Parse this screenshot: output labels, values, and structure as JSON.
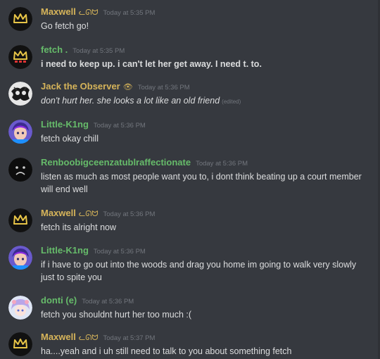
{
  "colors": {
    "background": "#36393f",
    "maxwell_name": "#d6b45a",
    "green_name": "#66bb6a",
    "timestamp": "#72767d",
    "message_text": "#dcddde"
  },
  "messages": [
    {
      "author": "Maxwell",
      "decoration": "ᓚᘏᗢ",
      "timestamp": "Today at 5:35 PM",
      "text": "Go fetch go!",
      "avatar": "crown-icon"
    },
    {
      "author": "fetch .",
      "timestamp": "Today at 5:35 PM",
      "text": "i need to keep up. i can't let her get away. I need t. to.",
      "avatar": "crown-icon"
    },
    {
      "author": "Jack the Observer",
      "decoration": "👁",
      "timestamp": "Today at 5:36 PM",
      "text": "don't hurt her. she looks a lot like an old friend",
      "edited": "(edited)",
      "avatar": "ink-avatar-icon"
    },
    {
      "author": "Little-K1ng",
      "timestamp": "Today at 5:36 PM",
      "text": "fetch okay chill",
      "avatar": "anime-avatar-icon"
    },
    {
      "author": "Renboobigceenzatublraffectionate",
      "timestamp": "Today at 5:36 PM",
      "text": "listen as much as most people want you to, i dont think beating up a court member will end well",
      "avatar": "sad-face-icon"
    },
    {
      "author": "Maxwell",
      "decoration": "ᓚᘏᗢ",
      "timestamp": "Today at 5:36 PM",
      "text": "fetch its alright now",
      "avatar": "crown-icon"
    },
    {
      "author": "Little-K1ng",
      "timestamp": "Today at 5:36 PM",
      "text": "if i have to go out into the woods and drag you home im going to walk very slowly just to spite you",
      "avatar": "anime-avatar-icon"
    },
    {
      "author": "donti (e)",
      "timestamp": "Today at 5:36 PM",
      "text": "fetch you shouldnt hurt her too much :(",
      "avatar": "anime-girl-avatar-icon"
    },
    {
      "author": "Maxwell",
      "decoration": "ᓚᘏᗢ",
      "timestamp": "Today at 5:37 PM",
      "text": "ha....yeah and i uh still need to talk to you about something fetch",
      "avatar": "crown-icon"
    }
  ]
}
